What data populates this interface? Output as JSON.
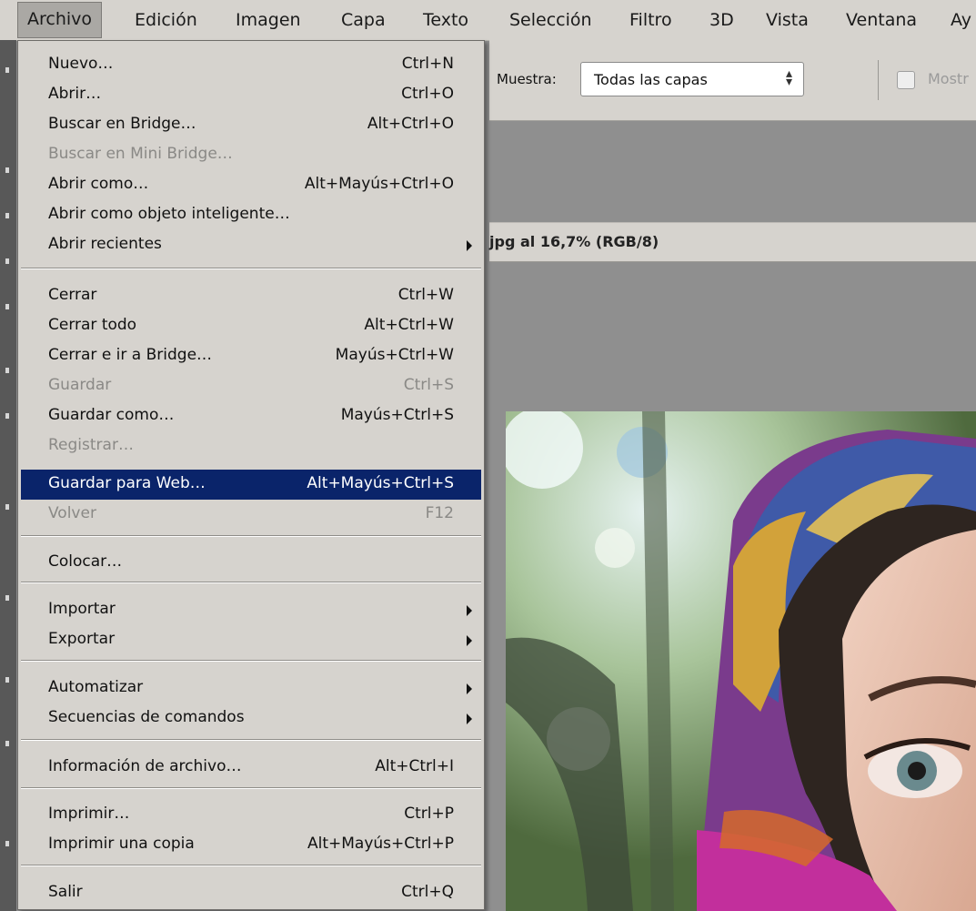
{
  "menubar": {
    "items": [
      "Archivo",
      "Edición",
      "Imagen",
      "Capa",
      "Texto",
      "Selección",
      "Filtro",
      "3D",
      "Vista",
      "Ventana",
      "Ay"
    ]
  },
  "options": {
    "muestra_label": "Muestra:",
    "muestra_value": "Todas las capas",
    "mostrar_label": "Mostr"
  },
  "document": {
    "title": "jpg al 16,7% (RGB/8)"
  },
  "menu": {
    "items": [
      {
        "label": "Nuevo…",
        "shortcut": "Ctrl+N"
      },
      {
        "label": "Abrir…",
        "shortcut": "Ctrl+O"
      },
      {
        "label": "Buscar en Bridge…",
        "shortcut": "Alt+Ctrl+O"
      },
      {
        "label": "Buscar en Mini Bridge…",
        "shortcut": ""
      },
      {
        "label": "Abrir como…",
        "shortcut": "Alt+Mayús+Ctrl+O"
      },
      {
        "label": "Abrir como objeto inteligente…",
        "shortcut": ""
      },
      {
        "label": "Abrir recientes",
        "shortcut": ""
      },
      {
        "label": "Cerrar",
        "shortcut": "Ctrl+W"
      },
      {
        "label": "Cerrar todo",
        "shortcut": "Alt+Ctrl+W"
      },
      {
        "label": "Cerrar e ir a Bridge…",
        "shortcut": "Mayús+Ctrl+W"
      },
      {
        "label": "Guardar",
        "shortcut": "Ctrl+S"
      },
      {
        "label": "Guardar como…",
        "shortcut": "Mayús+Ctrl+S"
      },
      {
        "label": "Registrar…",
        "shortcut": ""
      },
      {
        "label": "Guardar para Web…",
        "shortcut": "Alt+Mayús+Ctrl+S"
      },
      {
        "label": "Volver",
        "shortcut": "F12"
      },
      {
        "label": "Colocar…",
        "shortcut": ""
      },
      {
        "label": "Importar",
        "shortcut": ""
      },
      {
        "label": "Exportar",
        "shortcut": ""
      },
      {
        "label": "Automatizar",
        "shortcut": ""
      },
      {
        "label": "Secuencias de comandos",
        "shortcut": ""
      },
      {
        "label": "Información de archivo…",
        "shortcut": "Alt+Ctrl+I"
      },
      {
        "label": "Imprimir…",
        "shortcut": "Ctrl+P"
      },
      {
        "label": "Imprimir una copia",
        "shortcut": "Alt+Mayús+Ctrl+P"
      },
      {
        "label": "Salir",
        "shortcut": "Ctrl+Q"
      }
    ]
  },
  "colors": {
    "menu_bg": "#d6d3ce",
    "highlight": "#0a246a",
    "disabled_text": "#8a8986",
    "workspace": "#8f8f8f"
  }
}
